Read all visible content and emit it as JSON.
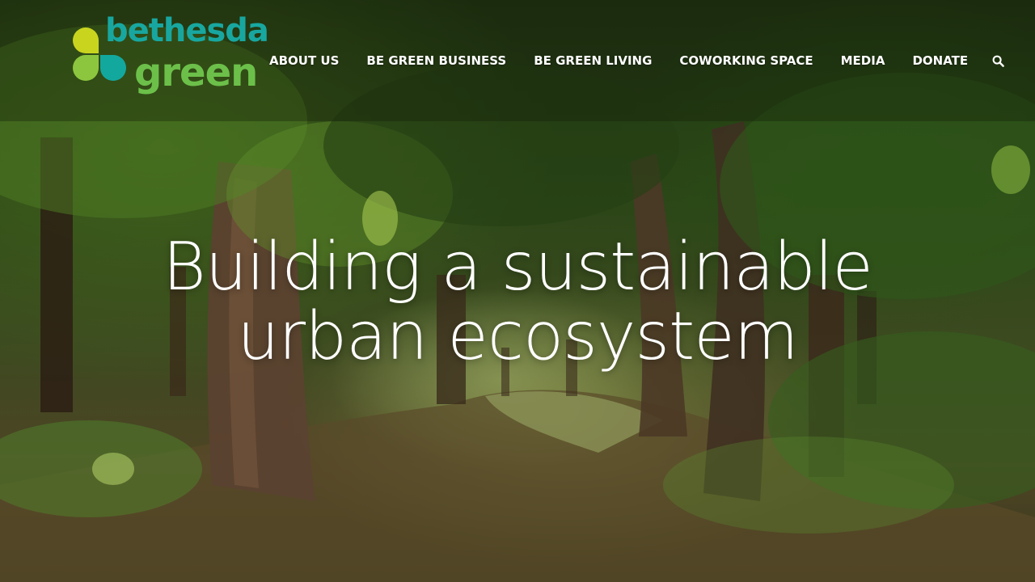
{
  "brand": {
    "name_line1": "bethesda",
    "name_line2": "green",
    "colors": {
      "yellow": "#c9d41f",
      "lime": "#8cc63f",
      "teal": "#13a89e",
      "green": "#6cc04a"
    }
  },
  "nav": {
    "items": [
      {
        "label": "ABOUT US"
      },
      {
        "label": "BE GREEN BUSINESS"
      },
      {
        "label": "BE GREEN LIVING"
      },
      {
        "label": "COWORKING SPACE"
      },
      {
        "label": "MEDIA"
      },
      {
        "label": "DONATE"
      }
    ],
    "search_icon": "search-icon"
  },
  "hero": {
    "headline_line1": "Building a sustainable",
    "headline_line2": "urban ecosystem",
    "background": "forest-path-photo"
  }
}
